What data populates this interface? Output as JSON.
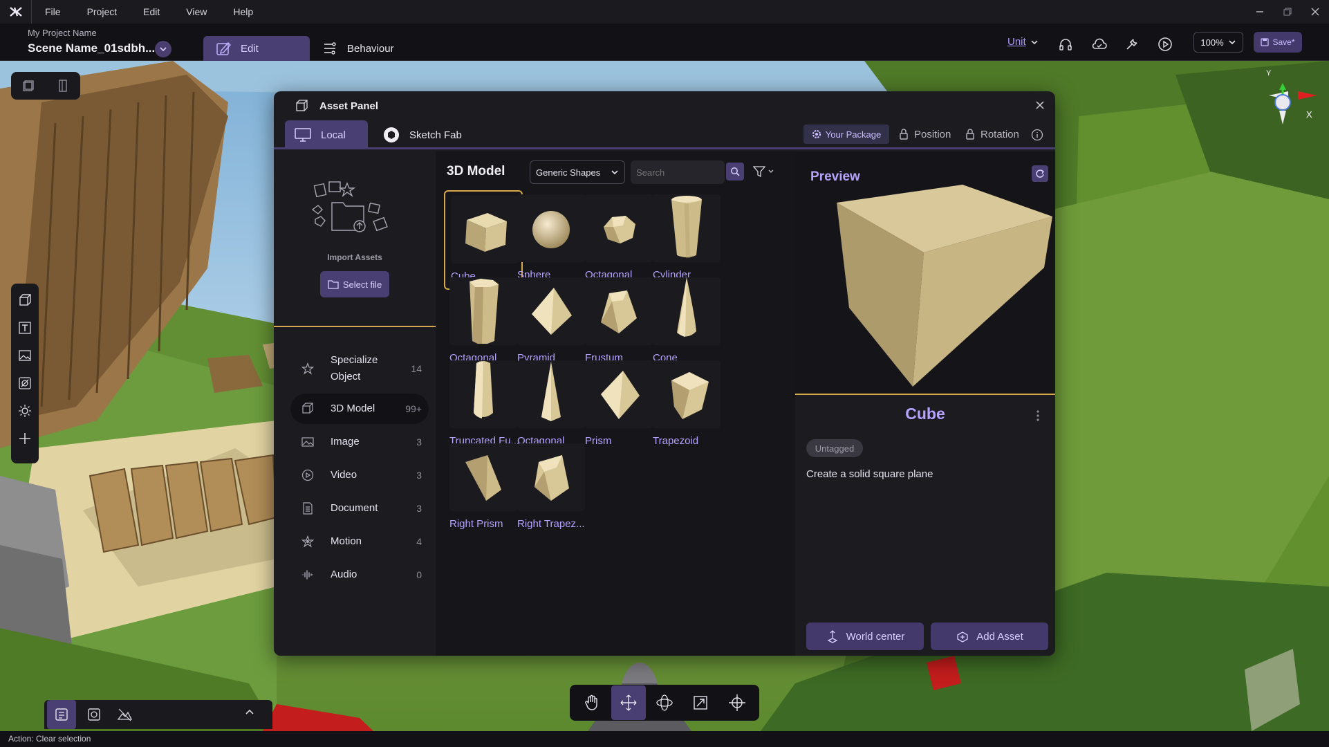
{
  "menubar": {
    "items": [
      "File",
      "Project",
      "Edit",
      "View",
      "Help"
    ]
  },
  "header": {
    "project_name": "My Project Name",
    "scene_name": "Scene Name_01sdbh...",
    "tabs": [
      {
        "label": "Edit",
        "active": true
      },
      {
        "label": "Behaviour",
        "active": false
      }
    ],
    "unit_label": "Unit",
    "zoom": "100%",
    "save_label": "Save*"
  },
  "gizmo": {
    "y_label": "Y",
    "x_label": "X"
  },
  "asset_panel": {
    "title": "Asset Panel",
    "tabs": [
      {
        "label": "Local",
        "active": true
      },
      {
        "label": "Sketch Fab",
        "active": false
      }
    ],
    "your_package": "Your Package",
    "position_label": "Position",
    "rotation_label": "Rotation",
    "import_label": "Import Assets",
    "select_file": "Select file",
    "categories": [
      {
        "label": "Specialize Object",
        "count": "14",
        "icon": "star-icon"
      },
      {
        "label": "3D Model",
        "count": "99+",
        "icon": "cube-icon",
        "active": true
      },
      {
        "label": "Image",
        "count": "3",
        "icon": "image-icon"
      },
      {
        "label": "Video",
        "count": "3",
        "icon": "video-icon"
      },
      {
        "label": "Document",
        "count": "3",
        "icon": "document-icon"
      },
      {
        "label": "Motion",
        "count": "4",
        "icon": "motion-icon"
      },
      {
        "label": "Audio",
        "count": "0",
        "icon": "audio-icon"
      }
    ],
    "grid": {
      "title": "3D Model",
      "dropdown": "Generic Shapes",
      "search_placeholder": "Search",
      "items": [
        "Cube",
        "Sphere",
        "Octagonal",
        "Cylinder",
        "Octagonal",
        "Pyramid",
        "Frustum",
        "Cone",
        "Truncated Fu...",
        "Octagonal",
        "Prism",
        "Trapezoid",
        "Right Prism",
        "Right Trapez..."
      ],
      "selected": "Cube"
    },
    "preview": {
      "title": "Preview",
      "object_name": "Cube",
      "tag": "Untagged",
      "description": "Create a solid square plane",
      "world_center": "World center",
      "add_asset": "Add Asset"
    }
  },
  "statusbar": {
    "text": "Action: Clear selection"
  },
  "colors": {
    "accent": "#4a3f72",
    "accent_text": "#b5a3ff",
    "highlight": "#d6a94a",
    "shape": "#d9c89a"
  }
}
